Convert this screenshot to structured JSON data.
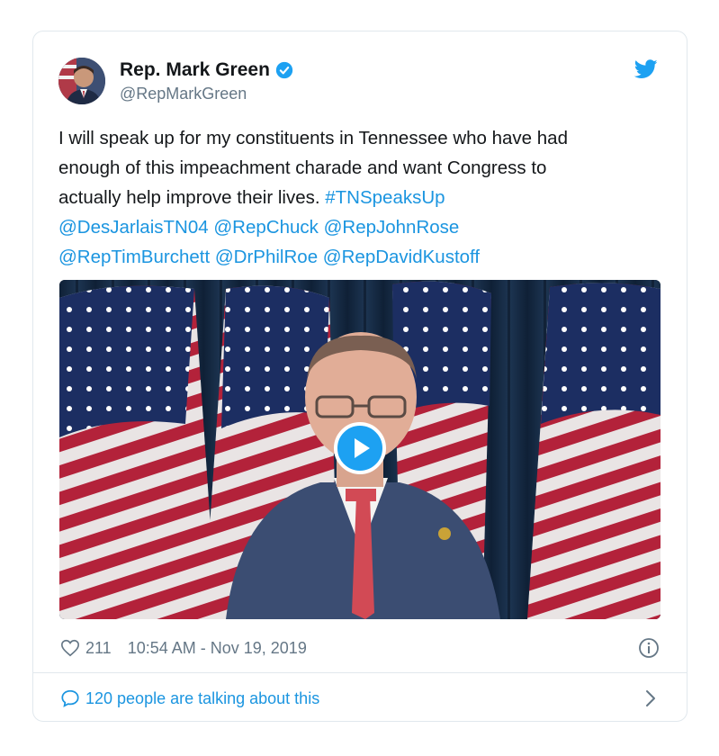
{
  "tweet": {
    "author_name": "Rep. Mark Green",
    "author_handle": "@RepMarkGreen",
    "text_lines": [
      "I will speak up for my constituents in Tennessee who have had",
      "enough of this impeachment charade and want Congress to",
      "actually help improve their lives."
    ],
    "hashtag": "#TNSpeaksUp",
    "mentions": [
      "@DesJarlaisTN04",
      "@RepChuck",
      "@RepJohnRose",
      "@RepTimBurchett",
      "@DrPhilRoe",
      "@RepDavidKustoff"
    ],
    "likes": "211",
    "timestamp": "10:54 AM - Nov 19, 2019",
    "conversation": "120 people are talking about this"
  },
  "icons": {
    "verified": "verified-badge-icon",
    "brand": "twitter-bird-icon",
    "like": "heart-icon",
    "info": "info-icon",
    "reply": "speech-bubble-icon",
    "chevron": "chevron-right-icon",
    "play": "play-icon"
  },
  "colors": {
    "link": "#1b95e0",
    "brand": "#1da1f2",
    "muted": "#657786",
    "text": "#14171a",
    "border": "#e1e8ed"
  }
}
